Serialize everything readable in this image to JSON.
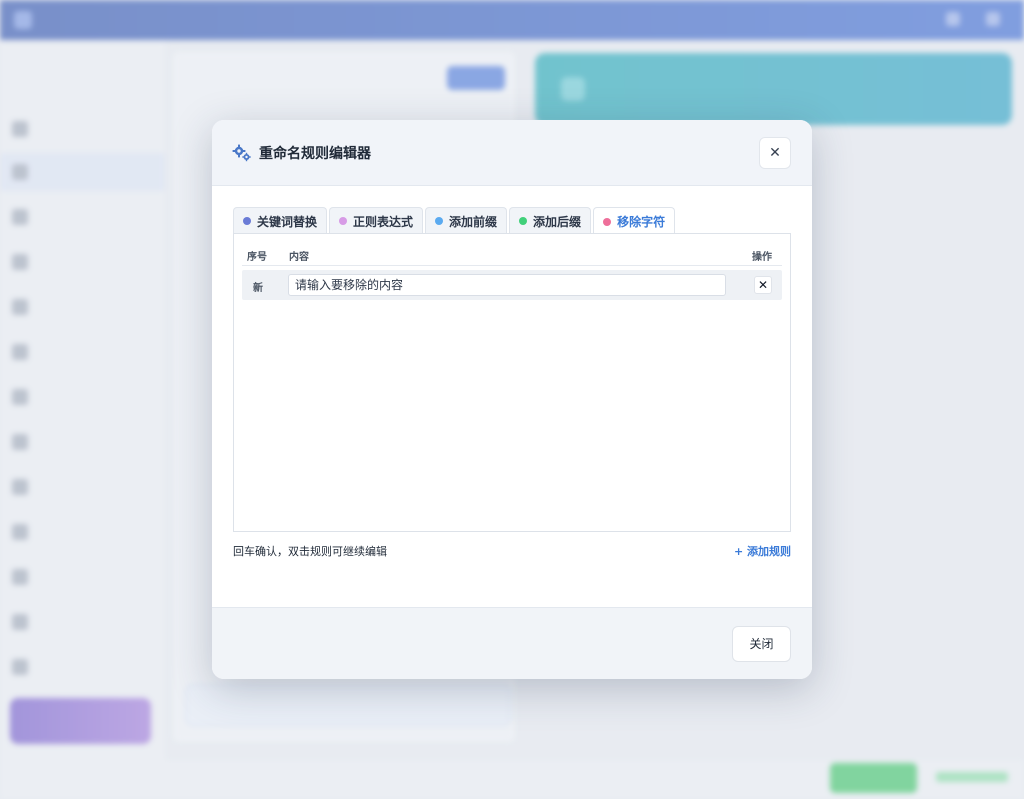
{
  "modal": {
    "title": "重命名规则编辑器",
    "close_symbol": "✕",
    "tabs": [
      {
        "label": "关键词替换",
        "color": "#6a7bd6"
      },
      {
        "label": "正则表达式",
        "color": "#d79be6"
      },
      {
        "label": "添加前缀",
        "color": "#5aaaf0"
      },
      {
        "label": "添加后缀",
        "color": "#41d07a"
      },
      {
        "label": "移除字符",
        "color": "#ee6f9a"
      }
    ],
    "active_tab_index": 4,
    "table": {
      "headers": {
        "seq": "序号",
        "content": "内容",
        "action": "操作"
      },
      "rows": [
        {
          "seq": "新",
          "placeholder": "请输入要移除的内容",
          "delete_symbol": "✕"
        }
      ]
    },
    "hint": "回车确认，双击规则可继续编辑",
    "add_rule": "+ 添加规则",
    "footer_close": "关闭"
  },
  "colors": {
    "accent": "#3b7bd8",
    "topbar": "#1f45a8",
    "banner": "#12a3b0"
  }
}
